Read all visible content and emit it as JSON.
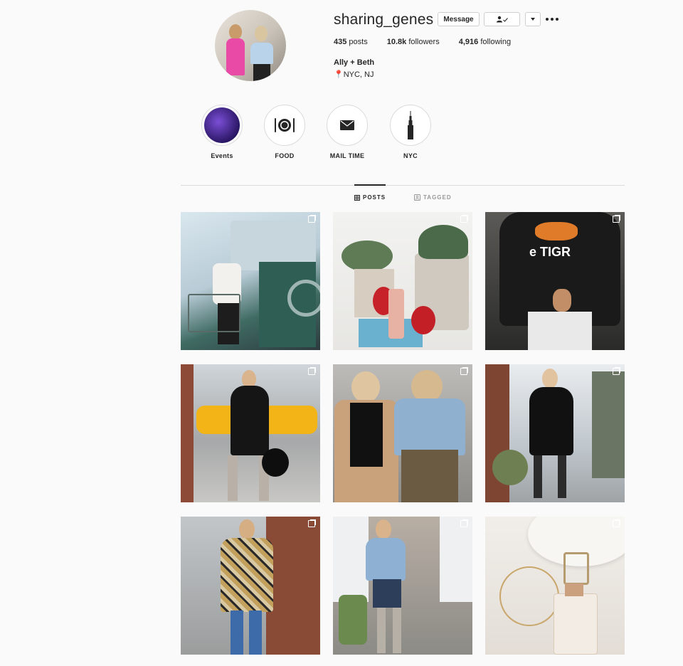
{
  "profile": {
    "username": "sharing_genes",
    "buttons": {
      "message": "Message"
    },
    "stats": [
      {
        "value": "435",
        "label": "posts"
      },
      {
        "value": "10.8k",
        "label": "followers"
      },
      {
        "value": "4,916",
        "label": "following"
      }
    ],
    "full_name": "Ally + Beth",
    "location": "NYC, NJ"
  },
  "highlights": [
    {
      "label": "Events",
      "icon": "events-cover-image"
    },
    {
      "label": "FOOD",
      "icon": "plate-utensils-icon"
    },
    {
      "label": "MAIL TIME",
      "icon": "envelope-icon"
    },
    {
      "label": "NYC",
      "icon": "empire-state-building-icon"
    }
  ],
  "tabs": {
    "posts": "POSTS",
    "tagged": "TAGGED"
  },
  "colors": {
    "background": "#fafafa",
    "text": "#262626",
    "border": "#dbdbdb",
    "pin": "#e0245e"
  },
  "posts": [
    {
      "subject": "laundromat-photo",
      "multi": true
    },
    {
      "subject": "strawberries-skincare-photo",
      "multi": true
    },
    {
      "subject": "tiger-sweater-photo",
      "multi": true
    },
    {
      "subject": "leather-dress-taxi-photo",
      "multi": true
    },
    {
      "subject": "two-friends-denim-photo",
      "multi": true
    },
    {
      "subject": "black-dress-street-photo",
      "multi": true
    },
    {
      "subject": "plaid-blazer-photo",
      "multi": true
    },
    {
      "subject": "denim-skirt-holiday-photo",
      "multi": true
    },
    {
      "subject": "jewelry-flatlay-photo",
      "multi": true
    }
  ]
}
